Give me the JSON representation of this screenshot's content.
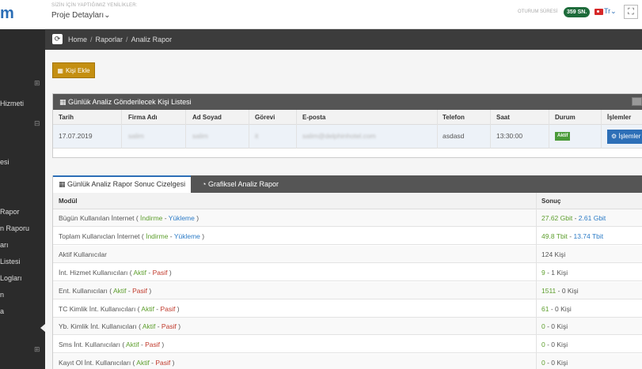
{
  "header": {
    "logo": "m",
    "news_label": "SİZİN İÇİN YAPTIĞIMIZ YENİLİKLER:",
    "news_value": "Proje Detayları",
    "session_label": "OTURUM SÜRESİ",
    "session_value": "359 SN.",
    "language": "Tr"
  },
  "sidebar": {
    "items": [
      "Hizmeti",
      "esi",
      "Rapor",
      "n Raporu",
      "arı",
      "Listesi",
      "Logları",
      "n",
      "a"
    ]
  },
  "breadcrumb": {
    "items": [
      "Home",
      "Raporlar",
      "Analiz Rapor"
    ]
  },
  "actions": {
    "add_person": "Kişi Ekle"
  },
  "person_list": {
    "title": "Günlük Analiz Gönderilecek Kişi Listesi",
    "columns": [
      "Tarih",
      "Firma Adı",
      "Ad Soyad",
      "Görevi",
      "E-posta",
      "Telefon",
      "Saat",
      "Durum",
      "İşlemler"
    ],
    "row": {
      "date": "17.07.2019",
      "company": "salim",
      "name": "salim",
      "role": "it",
      "email": "salim@delphinhotel.com",
      "phone": "asdasd",
      "time": "13:30:00",
      "status": "Aktif",
      "ops": "İşlemler"
    }
  },
  "report": {
    "tabs": [
      "Günlük Analiz Rapor Sonuc Cizelgesi",
      "Grafiksel Analiz Rapor"
    ],
    "columns": [
      "Modül",
      "Sonuç"
    ],
    "rows": [
      {
        "module": "Bügün Kullanılan İnternet",
        "a": "İndirme",
        "b": "Yükleme",
        "style": "dl",
        "v1": "27.62 Gbit",
        "v2": "2.61 Gbit"
      },
      {
        "module": "Toplam Kullanıclan İnternet",
        "a": "İndirme",
        "b": "Yükleme",
        "style": "dl",
        "v1": "49.8 Tbit",
        "v2": "13.74 Tbit"
      },
      {
        "module": "Aktif Kullanıcılar",
        "a": "",
        "b": "",
        "style": "plain",
        "v1": "124 Kişi",
        "v2": ""
      },
      {
        "module": "İnt. Hizmet Kullanıcıları",
        "a": "Aktif",
        "b": "Pasif",
        "style": "ap",
        "v1": "9",
        "v2": "1 Kişi"
      },
      {
        "module": "Ent. Kullanıcıları",
        "a": "Aktif",
        "b": "Pasif",
        "style": "ap",
        "v1": "1511",
        "v2": "0 Kişi"
      },
      {
        "module": "TC Kimlik İnt. Kullanıcıları",
        "a": "Aktif",
        "b": "Pasif",
        "style": "ap",
        "v1": "61",
        "v2": "0 Kişi"
      },
      {
        "module": "Yb. Kimlik İnt. Kullanıcıları",
        "a": "Aktif",
        "b": "Pasif",
        "style": "ap",
        "v1": "0",
        "v2": "0 Kişi"
      },
      {
        "module": "Sms İnt. Kullanıcıları",
        "a": "Aktif",
        "b": "Pasif",
        "style": "ap",
        "v1": "0",
        "v2": "0 Kişi"
      },
      {
        "module": "Kayıt Ol İnt. Kullanıcıları",
        "a": "Aktif",
        "b": "Pasif",
        "style": "ap",
        "v1": "0",
        "v2": "0 Kişi"
      }
    ]
  },
  "colors": {
    "accent": "#2d6fb7",
    "button_gold": "#c48f11",
    "session_green": "#1d6b3a",
    "sidebar": "#2b2b2b"
  }
}
